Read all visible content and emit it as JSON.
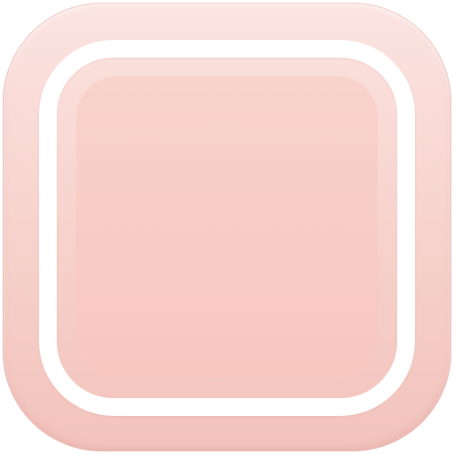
{
  "icon": {
    "name": "rounded-square-icon",
    "colors": {
      "tile_top": "#fbe4e1",
      "tile_bottom": "#f2c3bc",
      "frame": "#ffffff",
      "inner_fill": "#f8cbc4"
    }
  }
}
